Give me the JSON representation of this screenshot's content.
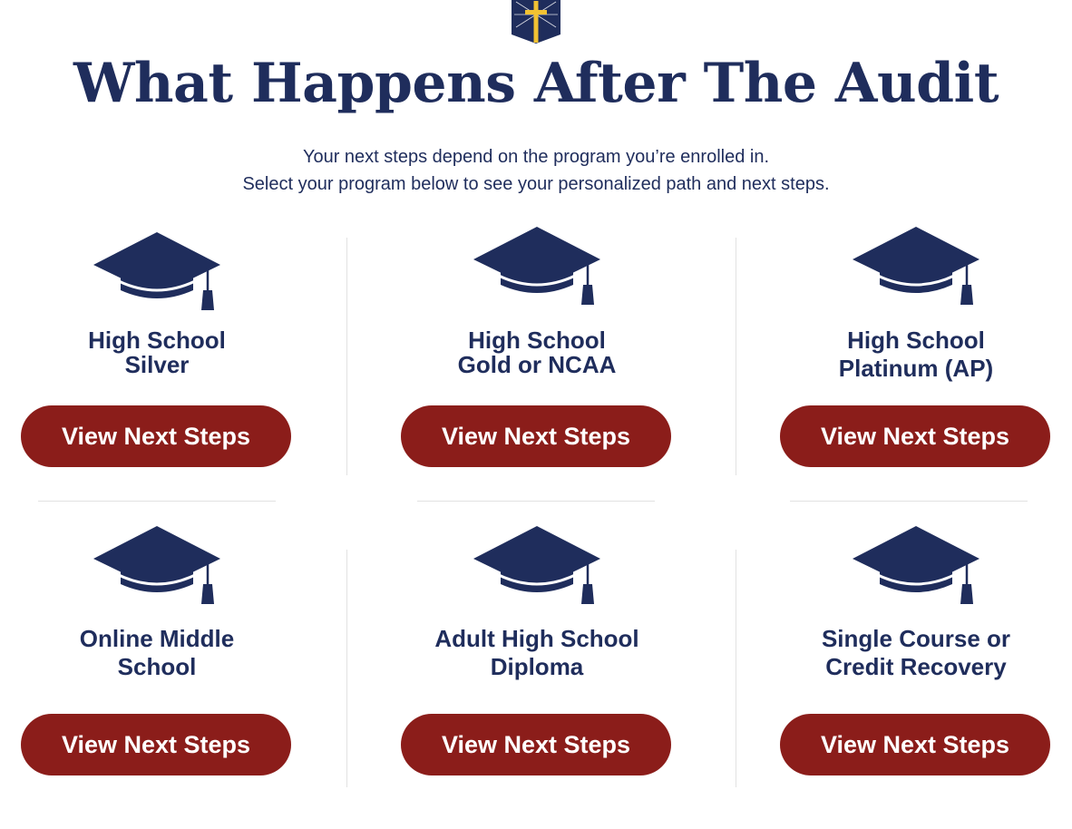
{
  "page": {
    "title": "What Happens After The Audit",
    "intro_line1": "Your next steps depend on the program you’re enrolled in.",
    "intro_line2": "Select your program below to see your personalized path and next steps."
  },
  "colors": {
    "navy": "#1f2d5c",
    "button": "#8b1d1a",
    "gold": "#f2c233"
  },
  "icons": {
    "logo": "cross-shield-icon",
    "program": "graduation-cap-icon"
  },
  "programs": [
    {
      "title_line1": "High School",
      "title_line2": "Silver",
      "button_label": "View Next Steps"
    },
    {
      "title_line1": "High School",
      "title_line2": "Gold or NCAA",
      "button_label": "View Next Steps"
    },
    {
      "title_line1": "High School",
      "title_line2": "Platinum (AP)",
      "button_label": "View Next Steps"
    },
    {
      "title_line1": "Online Middle",
      "title_line2": "School",
      "button_label": "View Next Steps"
    },
    {
      "title_line1": "Adult High School",
      "title_line2": "Diploma",
      "button_label": "View Next Steps"
    },
    {
      "title_line1": "Single Course or",
      "title_line2": "Credit Recovery",
      "button_label": "View Next Steps"
    }
  ]
}
